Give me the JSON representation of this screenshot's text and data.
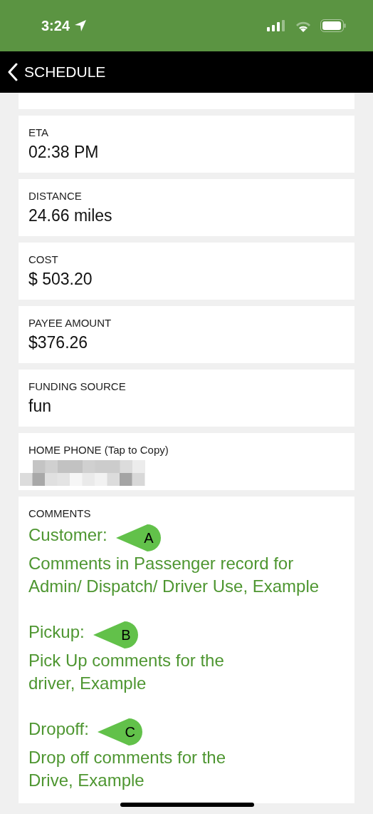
{
  "status_bar": {
    "time": "3:24"
  },
  "nav_bar": {
    "title": "SCHEDULE"
  },
  "fields": [
    {
      "label": "ETA",
      "value": "02:38 PM"
    },
    {
      "label": "DISTANCE",
      "value": "24.66 miles"
    },
    {
      "label": "COST",
      "value": "$ 503.20"
    },
    {
      "label": "PAYEE AMOUNT",
      "value": "$376.26"
    },
    {
      "label": "FUNDING SOURCE",
      "value": "fun"
    },
    {
      "label": "HOME PHONE (Tap to Copy)",
      "redacted": true
    }
  ],
  "comments": {
    "label": "COMMENTS",
    "items": [
      {
        "title": "Customer:",
        "marker": "A",
        "text": "Comments in Passenger record for\nAdmin/ Dispatch/ Driver Use, Example"
      },
      {
        "title": "Pickup:",
        "marker": "B",
        "text": "Pick Up comments for the\ndriver, Example"
      },
      {
        "title": "Dropoff:",
        "marker": "C",
        "text": "Drop off comments for the\nDrive, Example"
      }
    ]
  }
}
